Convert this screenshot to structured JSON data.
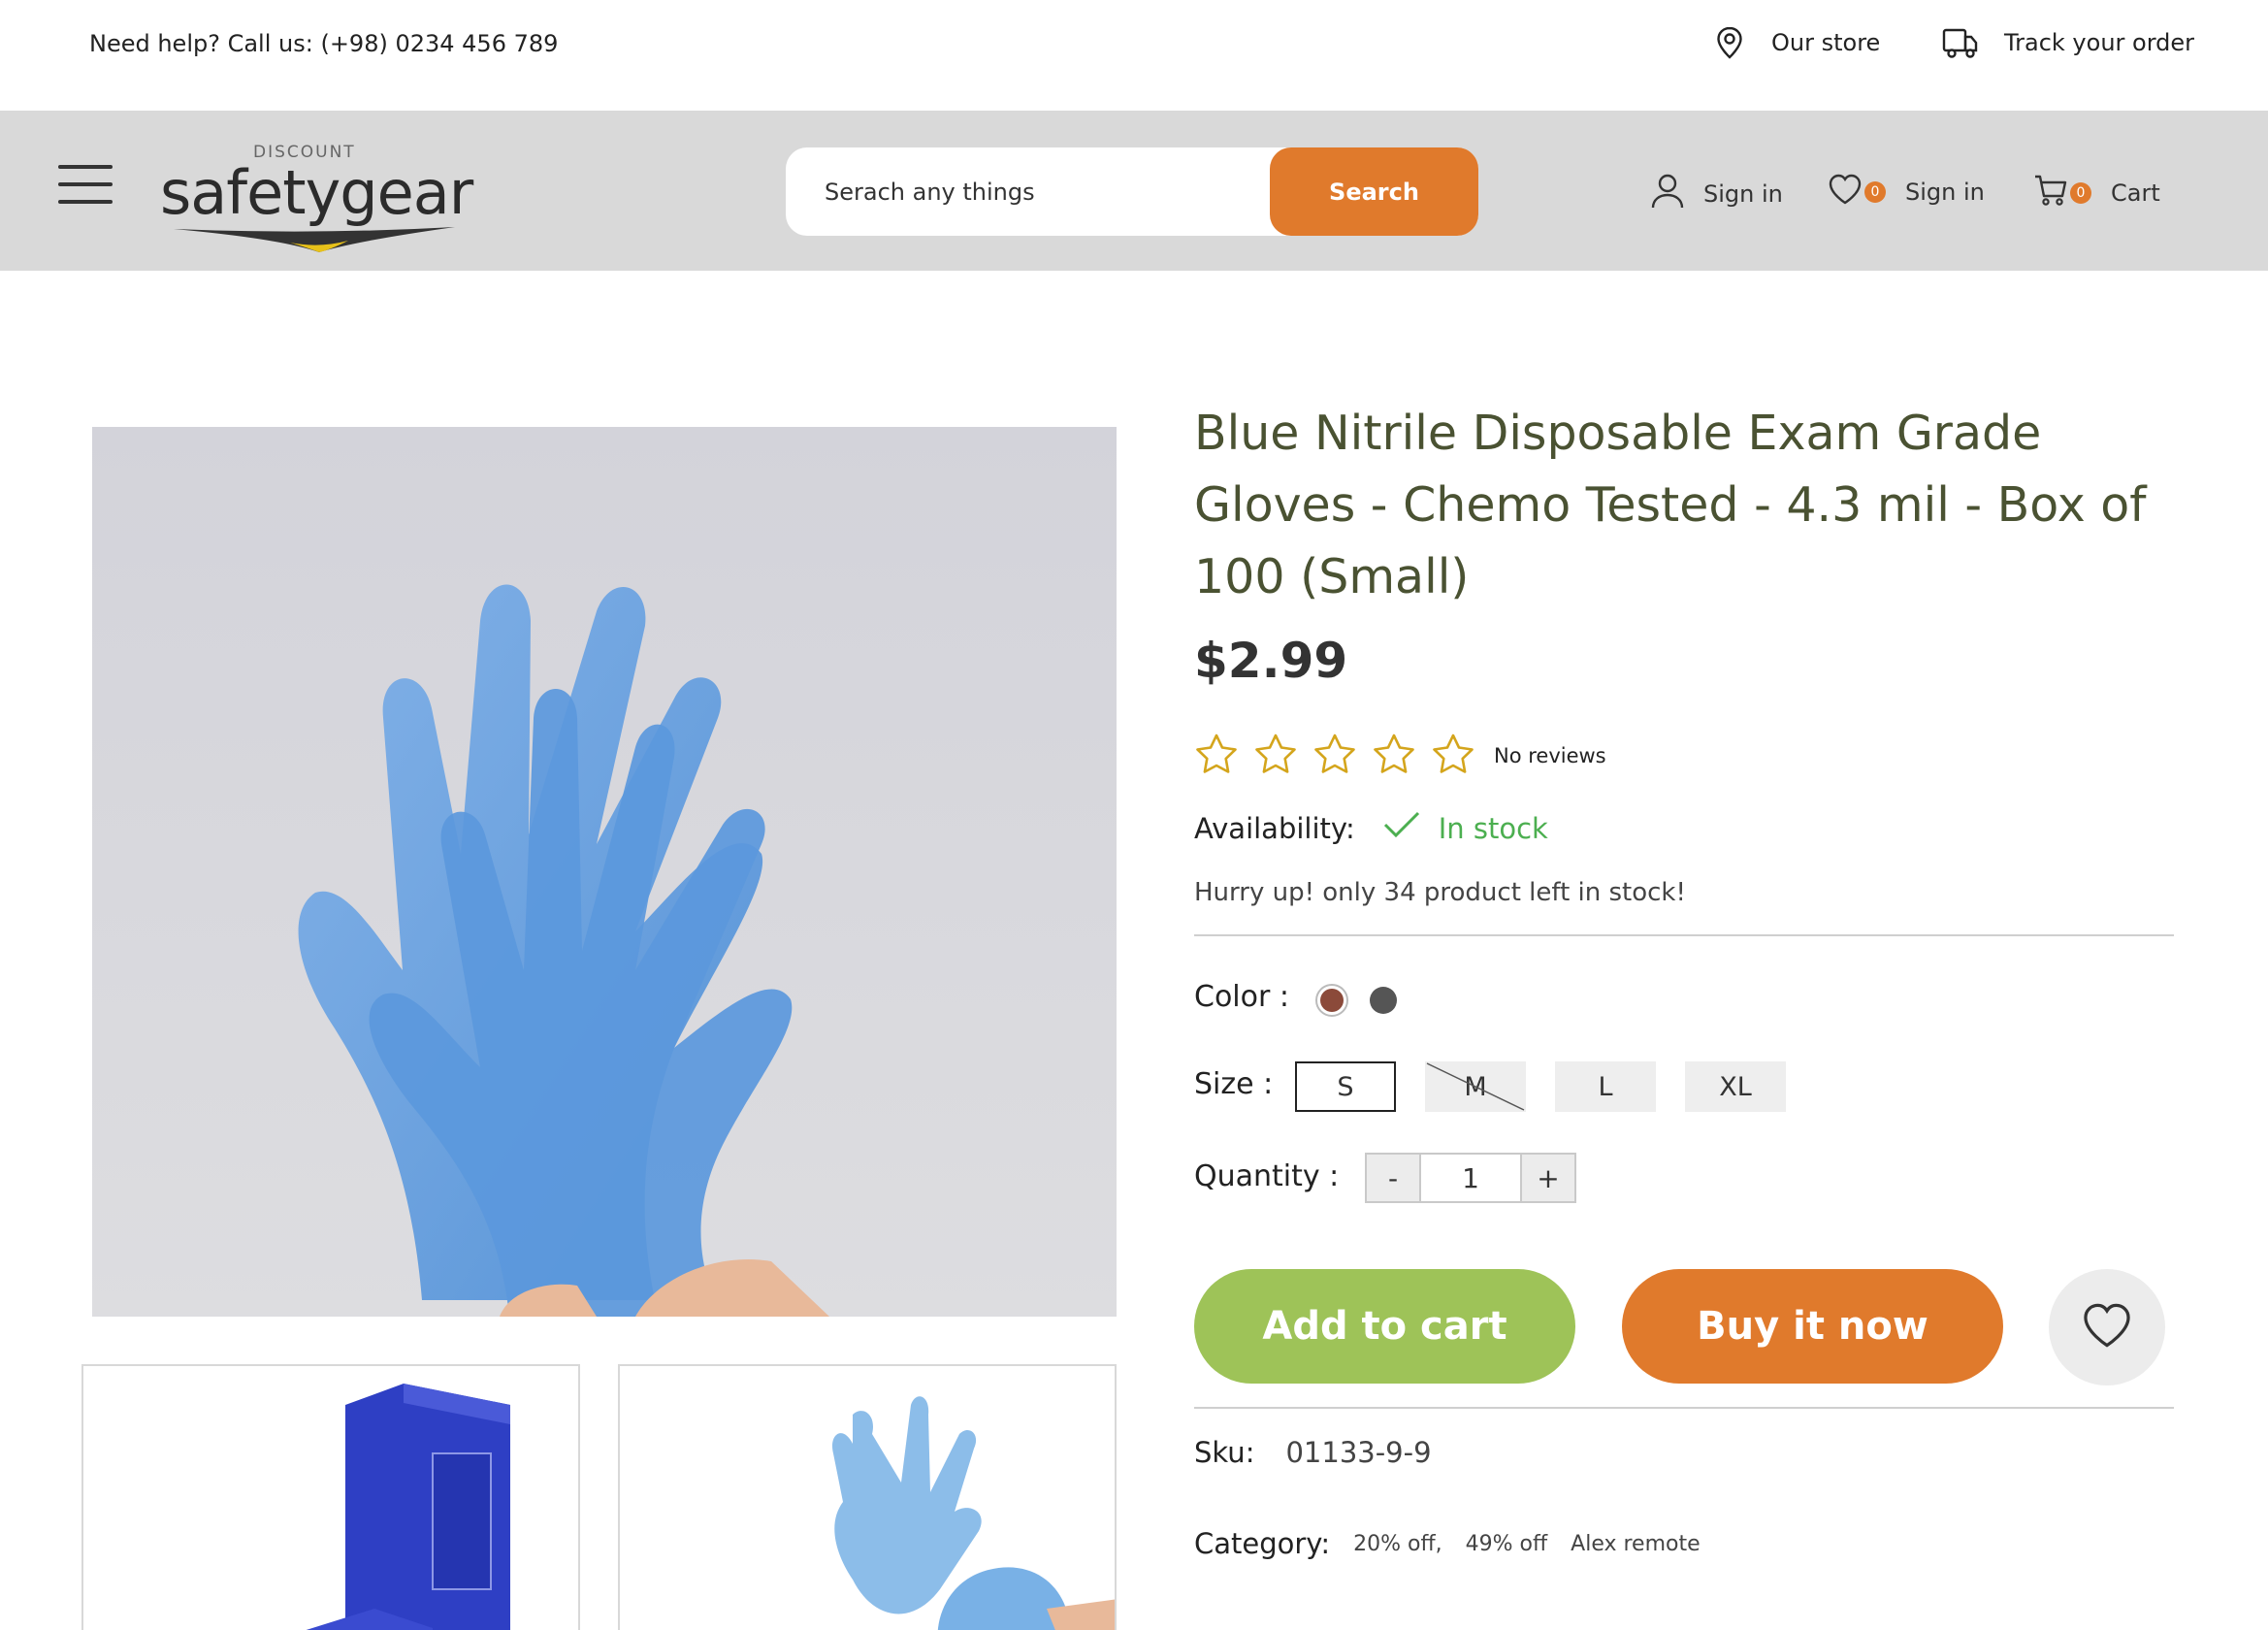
{
  "topbar": {
    "help_text": "Need help? Call us: (+98) 0234 456 789",
    "store_label": "Our store",
    "track_label": "Track your order"
  },
  "header": {
    "logo_small": "DISCOUNT",
    "logo_word": "safetygear",
    "search_placeholder": "Serach any things",
    "search_button": "Search",
    "signin_label": "Sign in",
    "wishlist_label": "Sign in",
    "wishlist_count": "0",
    "cart_label": "Cart",
    "cart_count": "0"
  },
  "product": {
    "title": "Blue Nitrile Disposable Exam Grade Gloves - Chemo Tested - 4.3 mil - Box of 100 (Small)",
    "price": "$2.99",
    "rating_stars": 0,
    "reviews_text": "No reviews",
    "availability_label": "Availability:",
    "availability_value": "In stock",
    "hurry_text": "Hurry up! only 34 product left in stock!",
    "color_label": "Color :",
    "colors": [
      "#8b4a3a",
      "#555555"
    ],
    "size_label": "Size :",
    "sizes": [
      "S",
      "M",
      "L",
      "XL"
    ],
    "selected_size": "S",
    "unavailable_size": "M",
    "quantity_label": "Quantity :",
    "qty_minus": "-",
    "qty_value": "1",
    "qty_plus": "+",
    "add_to_cart": "Add to cart",
    "buy_now": "Buy it now",
    "sku_label": "Sku:",
    "sku_value": "01133-9-9",
    "category_label": "Category:",
    "categories": [
      "20% off,",
      "49% off",
      "Alex remote"
    ]
  },
  "colors": {
    "accent_orange": "#e07a2c",
    "accent_green": "#9ec358",
    "title_color": "#4a5232",
    "stock_green": "#4caf50",
    "star_gold": "#d4a51c"
  }
}
